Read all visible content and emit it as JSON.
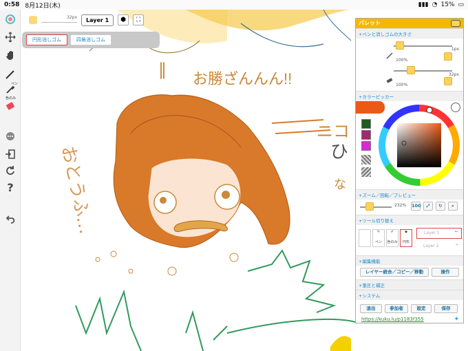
{
  "status": {
    "time": "0:58",
    "date": "8月12日(木)",
    "battery": "15%"
  },
  "topbar": {
    "size_label": "32px",
    "layer_label": "Layer 1"
  },
  "eraser_modes": [
    "円形消しゴム",
    "四角消しゴム"
  ],
  "sidebar": {
    "pen_label": "ペン",
    "eyedropper_label": "色のみ"
  },
  "palette": {
    "title": "パレット",
    "brush_section": "+ペンと消しゴムの大きさ",
    "pen_size": "1px",
    "pen_opacity": "100%",
    "eraser_size": "32px",
    "eraser_opacity": "100%",
    "color_section": "+カラーピッカー",
    "zoom_section": "+ズーム／回転／プレビュー",
    "zoom_value": "232%",
    "zoom_button": "100",
    "tool_section": "+ツール切り替え",
    "tool_labels": {
      "pen": "ペン",
      "color_only": "色のみ",
      "circle": "円形"
    },
    "layers": [
      "Layer 1",
      "Layer 2"
    ],
    "edit_section": "+編集機能",
    "edit_button": "レイヤー統合／コピー／移動",
    "operate_button": "操作",
    "pressure_section": "+筆圧と補正",
    "system_section": "+システム",
    "system_buttons": [
      "退出",
      "参加者",
      "設定",
      "保存"
    ],
    "link": "https://kuku.lu/p1183f355"
  },
  "colors": {
    "accent": "#f5b800",
    "current_color": "#ea5a16",
    "swatches": [
      "#1f5a1f",
      "#a02a6f",
      "#d42ad9"
    ],
    "link": "#2a8a2a"
  },
  "canvas_text": [
    "お勝ざんんん!!",
    "おとうふ…"
  ]
}
